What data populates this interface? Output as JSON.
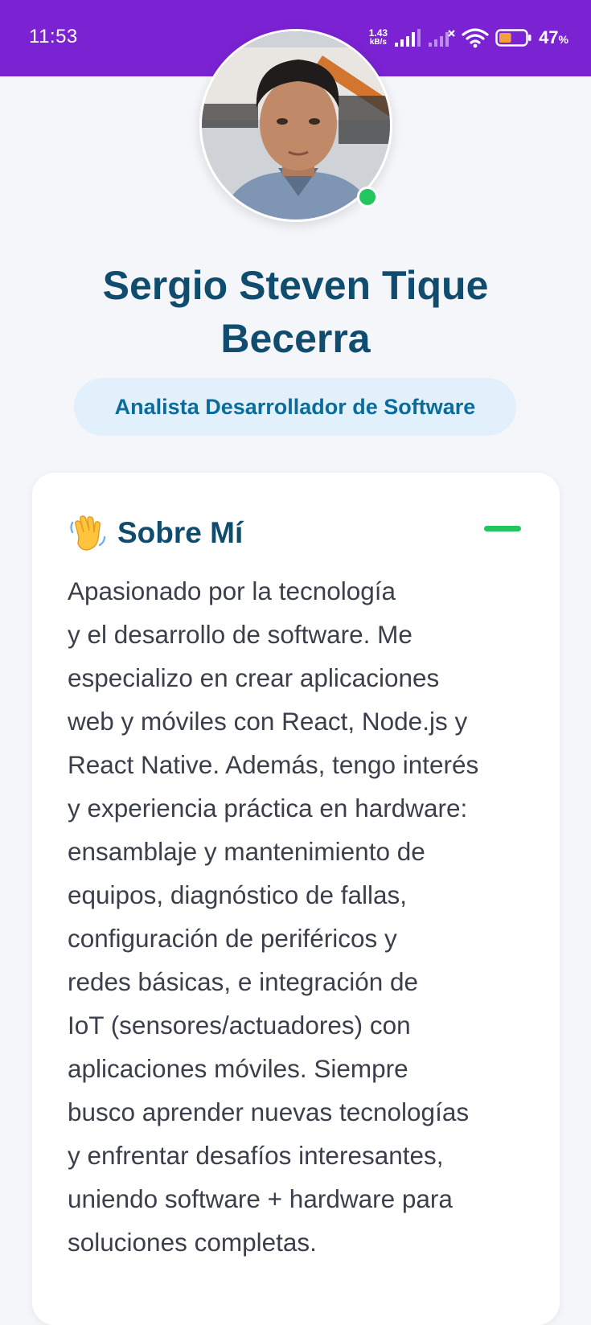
{
  "status_bar": {
    "time": "11:53",
    "net_speed_value": "1.43",
    "net_speed_unit": "kB/s",
    "battery_value": "47",
    "battery_unit": "%",
    "battery_level": 0.47,
    "icons": [
      "signal-icon",
      "signal-no-service-icon",
      "wifi-icon",
      "battery-icon"
    ]
  },
  "profile": {
    "avatar": "profile-photo",
    "online": true,
    "name": "Sergio Steven Tique Becerra",
    "role": "Analista Desarrollador de Software"
  },
  "about": {
    "icon": "waving-hand-icon",
    "title": "Sobre Mí",
    "lines": [
      "Apasionado por la tecnología",
      "y el desarrollo de software. Me",
      "especializo en crear aplicaciones",
      "web y móviles con React, Node.js y",
      "React Native. Además, tengo interés",
      "y experiencia práctica en hardware:",
      "ensamblaje y mantenimiento de",
      "equipos, diagnóstico de fallas,",
      "configuración de periféricos y",
      "redes básicas, e integración de",
      "IoT (sensores/actuadores) con",
      "aplicaciones móviles. Siempre",
      "busco aprender nuevas tecnologías",
      "y enfrentar desafíos interesantes,",
      "uniendo software + hardware para",
      "soluciones completas."
    ]
  },
  "colors": {
    "status_bar": "#7b22d3",
    "title": "#0f4c6d",
    "accent": "#22c55e",
    "pill_bg": "#e1f0fb",
    "pill_text": "#0b6c9c"
  }
}
